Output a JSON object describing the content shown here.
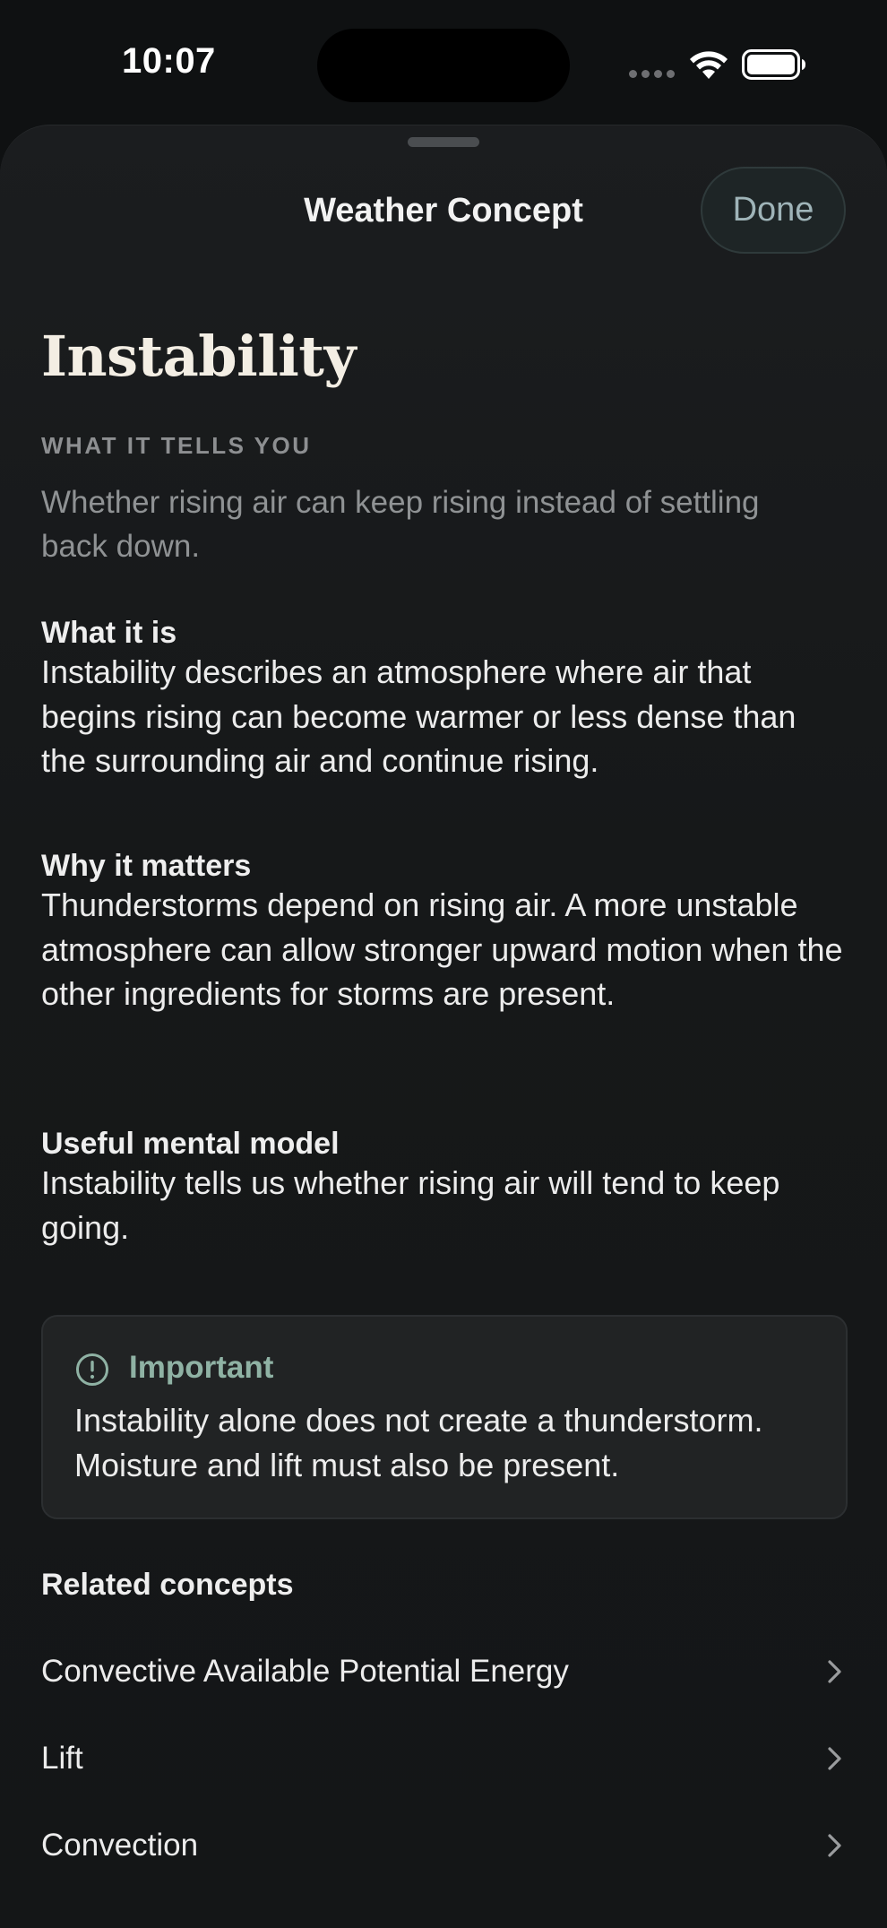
{
  "status_bar": {
    "time": "10:07"
  },
  "sheet": {
    "title": "Weather Concept",
    "done_label": "Done"
  },
  "concept": {
    "title": "Instability",
    "eyebrow": "WHAT IT TELLS YOU",
    "summary": "Whether rising air can keep rising instead of settling back down.",
    "sections": [
      {
        "heading": "What it is",
        "text": "Instability describes an atmosphere where air that begins rising can become warmer or less dense than the surrounding air and continue rising."
      },
      {
        "heading": "Why it matters",
        "text": "Thunderstorms depend on rising air. A more unstable atmosphere can allow stronger upward motion when the other ingredients for storms are present."
      },
      {
        "heading": "Useful mental model",
        "text": "Instability tells us whether rising air will tend to keep going."
      }
    ],
    "callout": {
      "icon": "exclamation-circle-icon",
      "title": "Important",
      "text": "Instability alone does not create a thunderstorm. Moisture and lift must also be present."
    },
    "related": {
      "heading": "Related concepts",
      "items": [
        {
          "label": "Convective Available Potential Energy"
        },
        {
          "label": "Lift"
        },
        {
          "label": "Convection"
        }
      ]
    }
  },
  "colors": {
    "background": "#0f1112",
    "sheet": "#1b1d1f",
    "accent": "#8fb2a4",
    "done_text": "#9fb4b8",
    "title_text": "#f3eee4",
    "muted_text": "#8f9294"
  }
}
